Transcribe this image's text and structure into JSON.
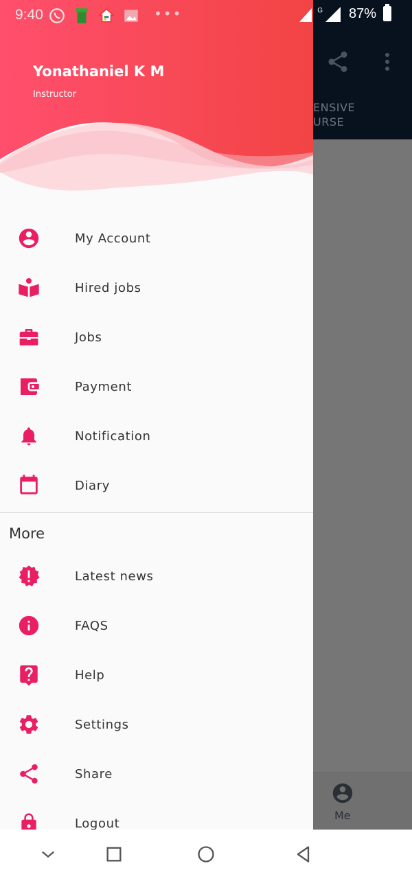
{
  "status_bar": {
    "time": "9:40",
    "battery": "87%",
    "network_label": "G"
  },
  "background_app": {
    "title_lines": [
      "ENSIVE",
      "URSE"
    ],
    "bottom_nav_me": "Me"
  },
  "drawer": {
    "user_name": "Yonathaniel K M",
    "user_role": "Instructor",
    "items": [
      {
        "label": "My Account",
        "icon": "account-circle-icon"
      },
      {
        "label": "Hired jobs",
        "icon": "book-reader-icon"
      },
      {
        "label": "Jobs",
        "icon": "briefcase-icon"
      },
      {
        "label": "Payment",
        "icon": "wallet-icon"
      },
      {
        "label": "Notification",
        "icon": "bell-icon"
      },
      {
        "label": "Diary",
        "icon": "calendar-icon"
      }
    ],
    "more_title": "More",
    "more_items": [
      {
        "label": "Latest news",
        "icon": "alert-badge-icon"
      },
      {
        "label": "FAQS",
        "icon": "info-icon"
      },
      {
        "label": "Help",
        "icon": "help-icon"
      },
      {
        "label": "Settings",
        "icon": "gear-icon"
      },
      {
        "label": "Share",
        "icon": "share-icon"
      },
      {
        "label": "Logout",
        "icon": "lock-icon"
      }
    ]
  },
  "colors": {
    "accent": "#e91e63",
    "header_gradient_start": "#ff4f6d",
    "header_gradient_end": "#f24444",
    "drawer_bg": "#fafafa",
    "scrim": "#767676",
    "appbar": "#08121e"
  }
}
